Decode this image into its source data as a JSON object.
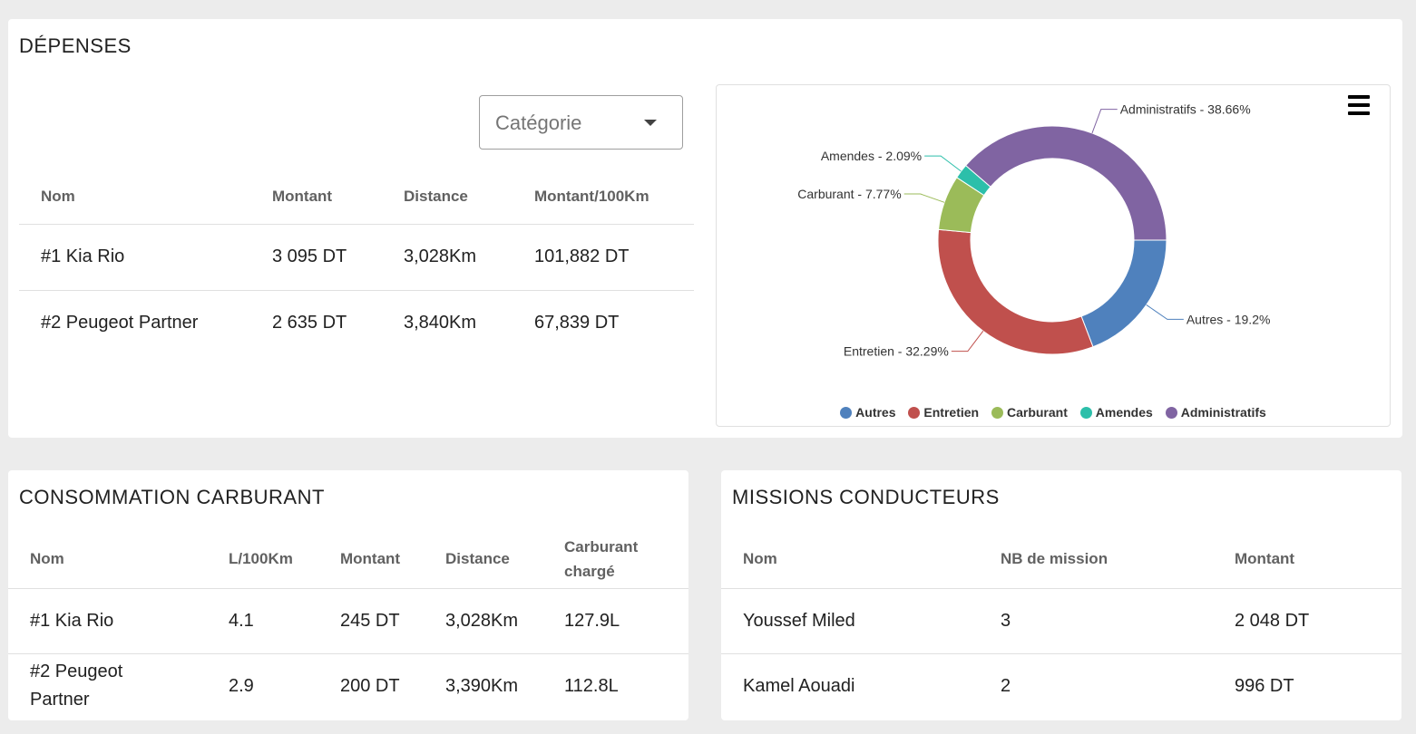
{
  "depenses": {
    "title": "DÉPENSES",
    "select": {
      "placeholder": "Catégorie",
      "icon": "caret-down-icon"
    },
    "columns": [
      "Nom",
      "Montant",
      "Distance",
      "Montant/100Km"
    ],
    "rows": [
      [
        "#1 Kia Rio",
        "3 095 DT",
        "3,028Km",
        "101,882 DT"
      ],
      [
        "#2 Peugeot Partner",
        "2 635 DT",
        "3,840Km",
        "67,839 DT"
      ]
    ],
    "menu_icon": "hamburger-menu-icon"
  },
  "chart_data": {
    "type": "pie",
    "donut": true,
    "categories": [
      "Autres",
      "Entretien",
      "Carburant",
      "Amendes",
      "Administratifs"
    ],
    "values": [
      19.2,
      32.29,
      7.77,
      2.09,
      38.66
    ],
    "unit": "%",
    "colors": [
      "#4f81bd",
      "#c0504d",
      "#9bbb59",
      "#2cbfaa",
      "#8064a2"
    ],
    "data_labels": [
      "Autres - 19.2%",
      "Entretien - 32.29%",
      "Carburant - 7.77%",
      "Amendes - 2.09%",
      "Administratifs - 38.66%"
    ],
    "legend": {
      "placement": "bottom",
      "items": [
        "Autres",
        "Entretien",
        "Carburant",
        "Amendes",
        "Administratifs"
      ]
    }
  },
  "consommation": {
    "title": "CONSOMMATION CARBURANT",
    "columns": [
      "Nom",
      "L/100Km",
      "Montant",
      "Distance",
      "Carburant chargé"
    ],
    "rows": [
      [
        "#1 Kia Rio",
        "4.1",
        "245 DT",
        "3,028Km",
        "127.9L"
      ],
      [
        "#2 Peugeot Partner",
        "2.9",
        "200 DT",
        "3,390Km",
        "112.8L"
      ]
    ]
  },
  "missions": {
    "title": "MISSIONS CONDUCTEURS",
    "columns": [
      "Nom",
      "NB de mission",
      "Montant"
    ],
    "rows": [
      [
        "Youssef Miled",
        "3",
        "2 048 DT"
      ],
      [
        "Kamel Aouadi",
        "2",
        "996 DT"
      ]
    ]
  }
}
